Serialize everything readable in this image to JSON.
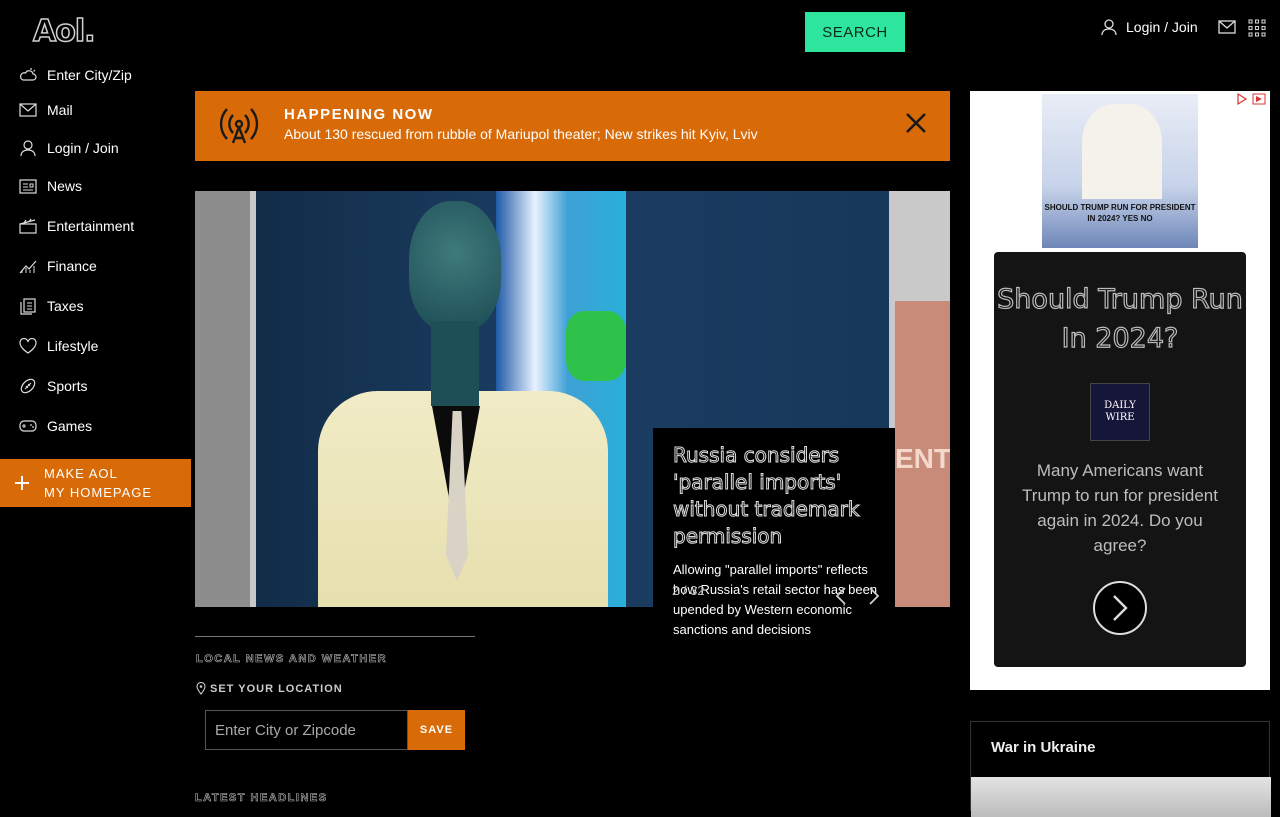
{
  "header": {
    "logo": "Aol.",
    "search_button": "SEARCH",
    "login": "Login / Join"
  },
  "sidebar": {
    "items": [
      {
        "label": "Enter City/Zip",
        "icon": "weather-icon"
      },
      {
        "label": "Mail",
        "icon": "mail-icon"
      },
      {
        "label": "Login / Join",
        "icon": "user-icon"
      },
      {
        "label": "News",
        "icon": "news-icon"
      },
      {
        "label": "Entertainment",
        "icon": "clapper-icon"
      },
      {
        "label": "Finance",
        "icon": "chart-icon"
      },
      {
        "label": "Taxes",
        "icon": "documents-icon"
      },
      {
        "label": "Lifestyle",
        "icon": "heart-icon"
      },
      {
        "label": "Sports",
        "icon": "football-icon"
      },
      {
        "label": "Games",
        "icon": "gamepad-icon"
      }
    ],
    "make_homepage_line1": "MAKE AOL",
    "make_homepage_line2": "MY HOMEPAGE"
  },
  "banner": {
    "kicker": "HAPPENING NOW",
    "text": "About 130 rescued from rubble of Mariupol theater; New strikes hit Kyiv, Lviv"
  },
  "hero": {
    "title": "Russia considers 'parallel imports' without trademark permission",
    "description": "Allowing \"parallel imports\" reflects how Russia's retail sector has been upended by Western economic sanctions and decisions",
    "counter": "2 / 32"
  },
  "local": {
    "heading": "LOCAL NEWS AND WEATHER",
    "set_location": "SET YOUR LOCATION",
    "input_placeholder": "Enter City or Zipcode",
    "save": "SAVE"
  },
  "latest_heading": "LATEST HEADLINES",
  "ad": {
    "image_caption": "SHOULD TRUMP RUN FOR PRESIDENT IN 2024? YES  NO",
    "question": "Should Trump Run In 2024?",
    "logo": "DAILY WIRE",
    "body": "Many Americans want Trump to run for president again in 2024. Do you agree?"
  },
  "ukraine": {
    "title": "War in Ukraine"
  },
  "colors": {
    "accent_orange": "#d86a08",
    "search_green": "#2ee59d",
    "background": "#000000"
  }
}
